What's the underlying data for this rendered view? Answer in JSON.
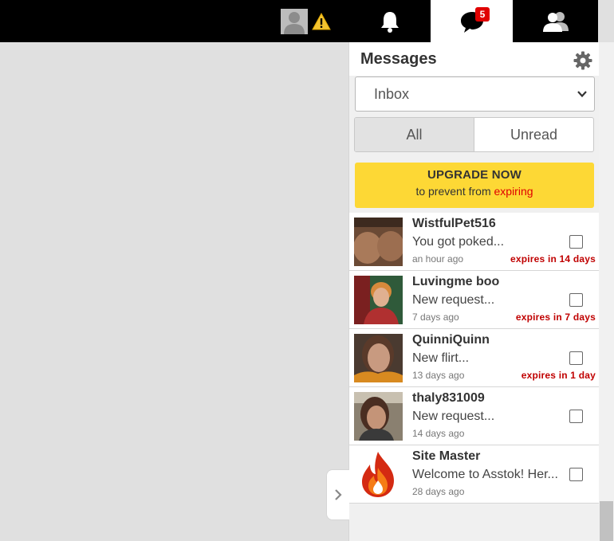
{
  "header": {
    "avatar_icon": "user-silhouette-icon",
    "warning_icon": "warning-triangle-icon",
    "notifications_icon": "bell-icon",
    "messages_icon": "chat-bubble-icon",
    "messages_badge": "5",
    "friends_icon": "users-icon"
  },
  "panel": {
    "title": "Messages",
    "settings_icon": "gear-icon",
    "folder_select": {
      "value": "Inbox",
      "options": [
        "Inbox"
      ]
    },
    "filter_tabs": [
      {
        "label": "All",
        "active": true
      },
      {
        "label": "Unread",
        "active": false
      }
    ],
    "upgrade": {
      "headline": "UPGRADE NOW",
      "line_prefix": "to prevent from",
      "line_highlight": "expiring"
    },
    "messages": [
      {
        "name": "WistfulPet516",
        "preview": "You got poked...",
        "time": "an hour ago",
        "expires": "expires in 14 days"
      },
      {
        "name": "Luvingme boo",
        "preview": "New request...",
        "time": "7 days ago",
        "expires": "expires in 7 days"
      },
      {
        "name": "QuinniQuinn",
        "preview": "New flirt...",
        "time": "13 days ago",
        "expires": "expires in 1 day"
      },
      {
        "name": "thaly831009",
        "preview": "New request...",
        "time": "14 days ago",
        "expires": ""
      },
      {
        "name": "Site Master",
        "preview": "Welcome to Asstok! Her...",
        "time": "28 days ago",
        "expires": ""
      }
    ]
  },
  "colors": {
    "topbar": "#000000",
    "badge": "#e00000",
    "upgrade_bg": "#fdd835",
    "expire_text": "#c00000"
  }
}
